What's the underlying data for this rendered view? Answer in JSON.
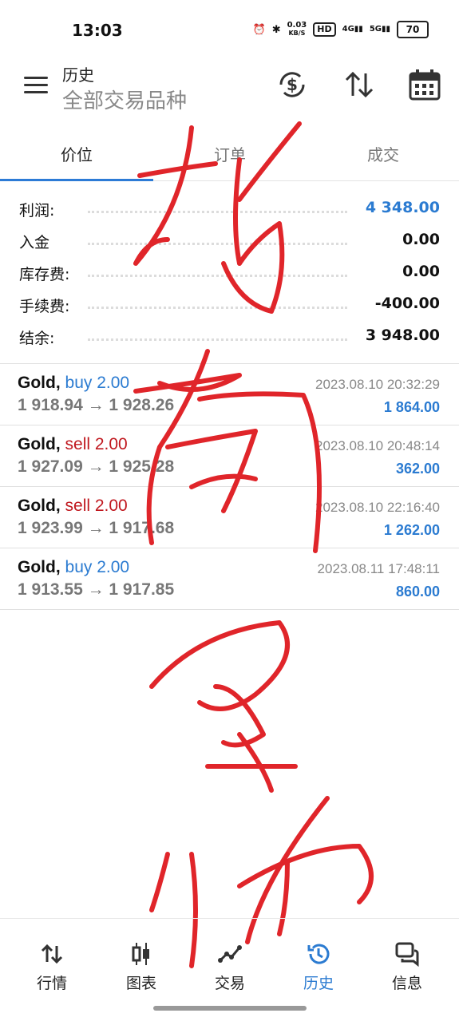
{
  "status": {
    "time": "13:03",
    "speed_value": "0.03",
    "speed_unit": "KB/S",
    "hd": "HD",
    "net1": "4G",
    "net2": "5G",
    "battery": "70"
  },
  "header": {
    "title": "历史",
    "subtitle": "全部交易品种"
  },
  "tabs": [
    {
      "label": "价位",
      "active": true
    },
    {
      "label": "订单",
      "active": false
    },
    {
      "label": "成交",
      "active": false
    }
  ],
  "summary": [
    {
      "label": "利润:",
      "value": "4 348.00",
      "highlight": true
    },
    {
      "label": "入金",
      "value": "0.00"
    },
    {
      "label": "库存费:",
      "value": "0.00"
    },
    {
      "label": "手续费:",
      "value": "-400.00"
    },
    {
      "label": "结余:",
      "value": "3 948.00"
    }
  ],
  "trades": [
    {
      "symbol": "Gold,",
      "side": "buy 2.00",
      "side_type": "buy",
      "prices": "1 918.94 → 1 928.26",
      "time": "2023.08.10 20:32:29",
      "profit": "1 864.00"
    },
    {
      "symbol": "Gold,",
      "side": "sell 2.00",
      "side_type": "sell",
      "prices": "1 927.09 → 1 925.28",
      "time": "2023.08.10 20:48:14",
      "profit": "362.00"
    },
    {
      "symbol": "Gold,",
      "side": "sell 2.00",
      "side_type": "sell",
      "prices": "1 923.99 → 1 917.68",
      "time": "2023.08.10 22:16:40",
      "profit": "1 262.00"
    },
    {
      "symbol": "Gold,",
      "side": "buy 2.00",
      "side_type": "buy",
      "prices": "1 913.55 → 1 917.85",
      "time": "2023.08.11 17:48:11",
      "profit": "860.00"
    }
  ],
  "nav": [
    {
      "label": "行情",
      "icon": "quotes-icon"
    },
    {
      "label": "图表",
      "icon": "chart-icon"
    },
    {
      "label": "交易",
      "icon": "trade-icon"
    },
    {
      "label": "历史",
      "icon": "history-icon",
      "active": true
    },
    {
      "label": "信息",
      "icon": "messages-icon"
    }
  ],
  "colors": {
    "accent": "#2b7bd1",
    "sell": "#c0171e",
    "handwriting": "#e0252a"
  }
}
